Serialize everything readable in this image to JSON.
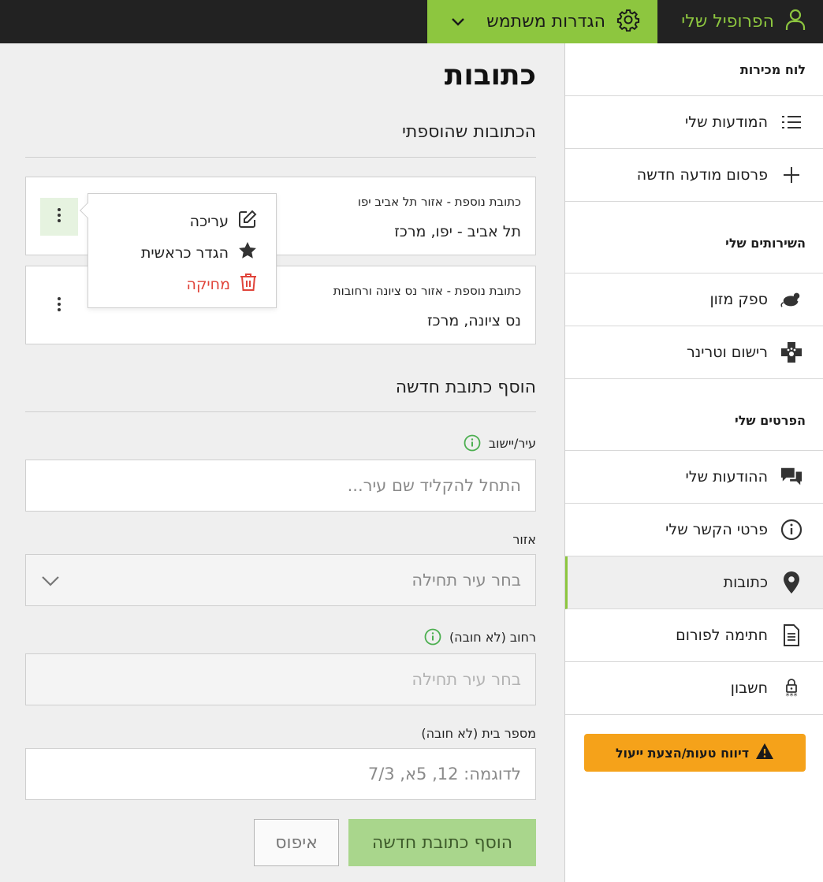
{
  "topbar": {
    "profile_label": "הפרופיל שלי",
    "settings_label": "הגדרות משתמש",
    "accent": "#8dc63f"
  },
  "sidebar": {
    "dashboard": "לוח מכירות",
    "items_top": [
      {
        "label": "המודעות שלי",
        "icon": "list-icon"
      },
      {
        "label": "פרסום מודעה חדשה",
        "icon": "plus-icon"
      }
    ],
    "services_heading": "השירותים שלי",
    "services": [
      {
        "label": "ספק מזון",
        "icon": "mouse-icon"
      },
      {
        "label": "רישום וטרינר",
        "icon": "vet-cross-icon"
      }
    ],
    "details_heading": "הפרטים שלי",
    "details": [
      {
        "label": "ההודעות שלי",
        "icon": "chat-bubbles-icon"
      },
      {
        "label": "פרטי הקשר שלי",
        "icon": "info-icon"
      },
      {
        "label": "כתובות",
        "icon": "location-pin-icon",
        "active": true
      },
      {
        "label": "חתימה לפורום",
        "icon": "document-icon"
      },
      {
        "label": "חשבון",
        "icon": "password-lock-icon"
      }
    ],
    "report_label": "דיווח טעות/הצעת ייעול",
    "report_color": "#f5a21a"
  },
  "main": {
    "title": "כתובות",
    "added_heading": "הכתובות שהוספתי",
    "addresses": [
      {
        "label": "כתובת נוספת - אזור תל אביב יפו",
        "value": "תל אביב - יפו, מרכז"
      },
      {
        "label": "כתובת נוספת - אזור נס ציונה ורחובות",
        "value": "נס ציונה, מרכז"
      }
    ],
    "menu": {
      "edit": "עריכה",
      "set_primary": "הגדר כראשית",
      "delete": "מחיקה"
    },
    "new_heading": "הוסף כתובת חדשה",
    "form": {
      "city_label": "עיר/יישוב",
      "city_placeholder": "התחל להקליד שם עיר...",
      "area_label": "אזור",
      "area_placeholder": "בחר עיר תחילה",
      "street_label": "רחוב (לא חובה)",
      "street_placeholder": "בחר עיר תחילה",
      "house_label": "מספר בית (לא חובה)",
      "house_placeholder": "לדוגמה: 12, 5א, 7/3"
    },
    "add_button": "הוסף כתובת חדשה",
    "reset_button": "איפוס"
  }
}
